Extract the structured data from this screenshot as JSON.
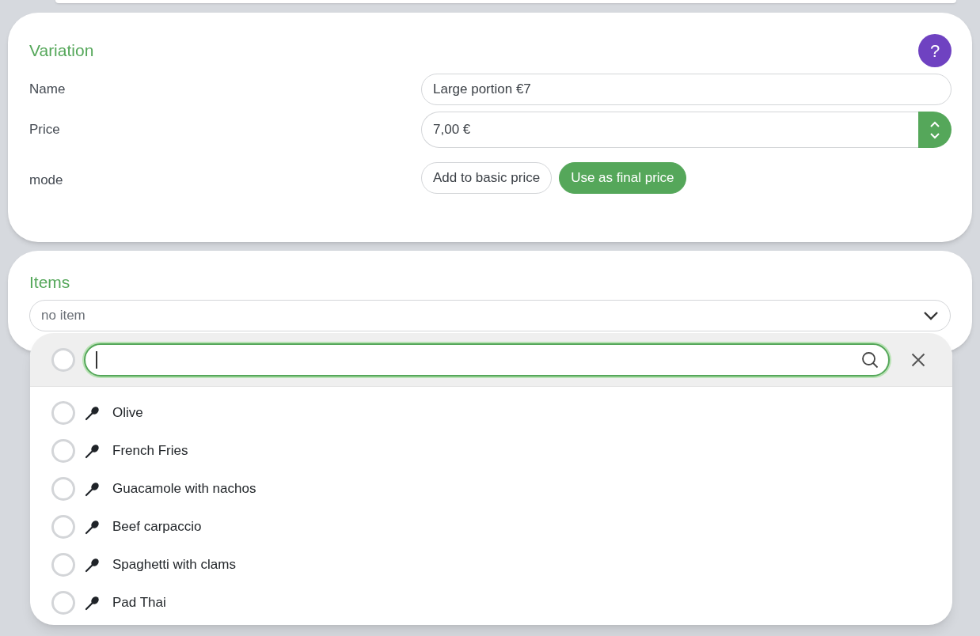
{
  "variation": {
    "title": "Variation",
    "help": "?",
    "fields": [
      {
        "label": "Name",
        "value": "Large portion €7",
        "kind": "text"
      },
      {
        "label": "Price",
        "value": "7,00 €",
        "kind": "number"
      }
    ],
    "mode": {
      "label": "mode",
      "options": [
        {
          "label": "Add to basic price",
          "selected": false
        },
        {
          "label": "Use as final price",
          "selected": true
        }
      ]
    }
  },
  "items": {
    "title": "Items",
    "select": {
      "placeholder": "no item",
      "expanded": true
    },
    "dropdown": {
      "select_all": {
        "checked": false
      },
      "options": [
        {
          "label": "Olive",
          "checked": false
        },
        {
          "label": "French Fries",
          "checked": false
        },
        {
          "label": "Guacamole with nachos",
          "checked": false
        },
        {
          "label": "Beef carpaccio",
          "checked": false
        },
        {
          "label": "Spaghetti with clams",
          "checked": false
        },
        {
          "label": "Pad Thai",
          "checked": false
        }
      ]
    }
  }
}
